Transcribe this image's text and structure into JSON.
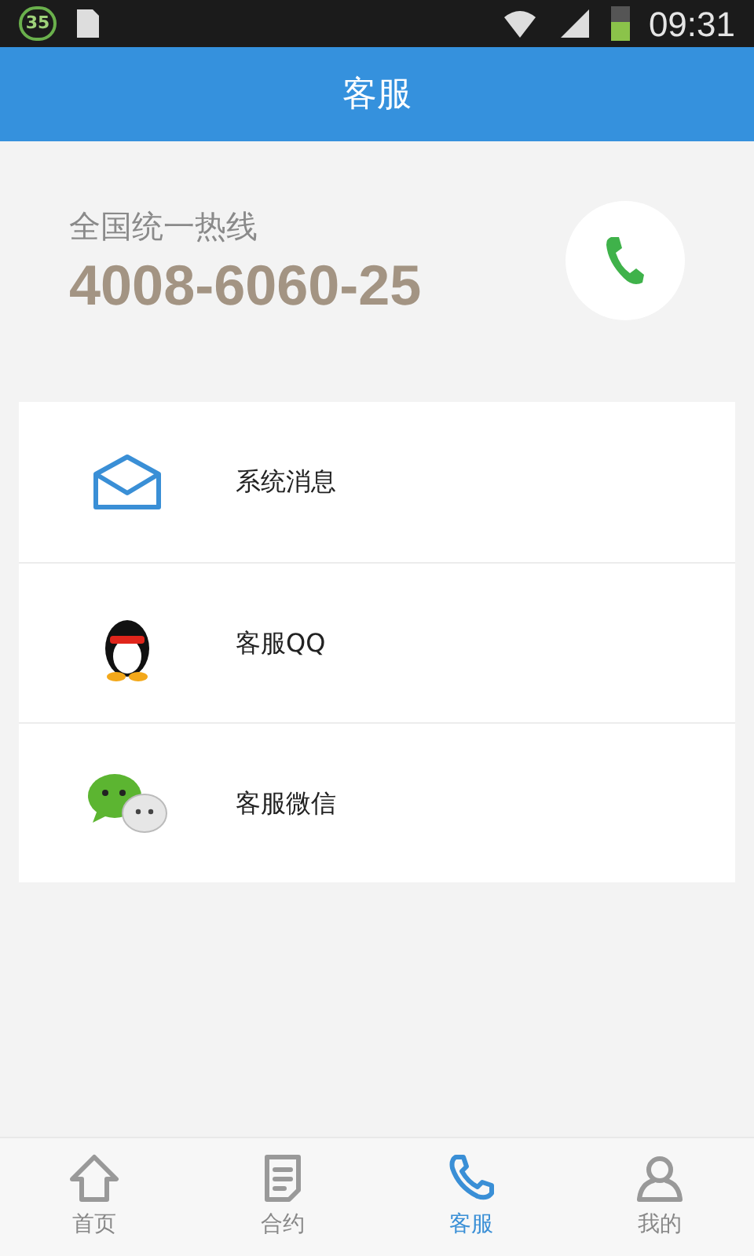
{
  "status_bar": {
    "badge": "35",
    "time": "09:31"
  },
  "header": {
    "title": "客服"
  },
  "hotline": {
    "label": "全国统一热线",
    "number": "4008-6060-25"
  },
  "menu": [
    {
      "kind": "mail",
      "label": "系统消息"
    },
    {
      "kind": "qq",
      "label": "客服QQ"
    },
    {
      "kind": "wechat",
      "label": "客服微信"
    }
  ],
  "tabs": [
    {
      "kind": "home",
      "label": "首页",
      "selected": false
    },
    {
      "kind": "contract",
      "label": "合约",
      "selected": false
    },
    {
      "kind": "service",
      "label": "客服",
      "selected": true
    },
    {
      "kind": "profile",
      "label": "我的",
      "selected": false
    }
  ]
}
